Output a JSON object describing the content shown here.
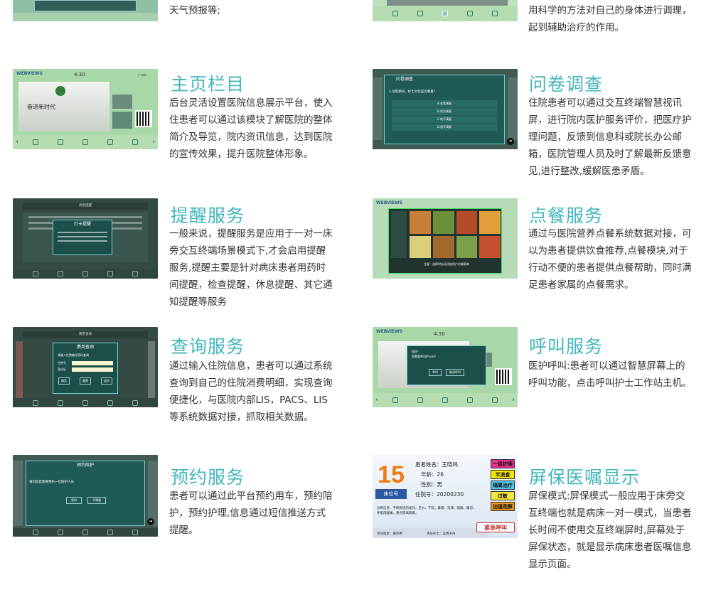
{
  "features": [
    {
      "id": "weather",
      "title": "",
      "desc": "天气预报等;"
    },
    {
      "id": "treatment",
      "title": "",
      "desc": "用科学的方法对自己的身体进行调理，起到辅助治疗的作用。"
    },
    {
      "id": "homepage",
      "title": "主页栏目",
      "desc": "后台灵活设置医院信息展示平台，使入住患者可以通过该模块了解医院的整体简介及导览，院内资讯信息，达到医院的宣传效果，提升医院整体形象。"
    },
    {
      "id": "survey",
      "title": "问卷调查",
      "desc": "住院患者可以通过交互终端智慧视讯屏，进行院内医护服务评价，把医疗护理问题，反馈到信息科或院长办公邮箱，医院管理人员及时了解最新反馈意见,进行整改,缓解医患矛盾。"
    },
    {
      "id": "reminder",
      "title": "提醒服务",
      "desc": "一般来说，提醒服务是应用于一对一床旁交互终端场景模式下,才会启用提醒服务,提醒主要是针对病床患者用药时间提醒，检查提醒，休息提醒、其它通知提醒等服务"
    },
    {
      "id": "ordering",
      "title": "点餐服务",
      "desc": "通过与医院营养点餐系统数据对接，可以为患者提供饮食推荐,点餐模块,对于行动不便的患者提供点餐帮助，同时满足患者家属的点餐需求。"
    },
    {
      "id": "query",
      "title": "查询服务",
      "desc": "通过输入住院信息，患者可以通过系统查询到自己的住院消费明细，实现查询便捷化，与医院内部LIS，PACS、LIS等系统数据对接，抓取相关数据。"
    },
    {
      "id": "call",
      "title": "呼叫服务",
      "desc": "医护呼叫:患者可以通过智慧屏幕上的呼叫功能，点击呼叫护士工作站主机。"
    },
    {
      "id": "booking",
      "title": "预约服务",
      "desc": "患者可以通过此平台预约用车，预约陪护，预约护理,信息通过短信推送方式提醒。"
    },
    {
      "id": "screensaver",
      "title": "屏保医嘱显示",
      "desc": "屏保模式:屏保模式一般应用于床旁交互终端也就是病床一对一模式，当患者长时间不使用交互终端屏时,屏幕处于屏保状态，就是显示病床患者医嘱信息显示页面。"
    }
  ],
  "screens": {
    "homepage": {
      "logo": "WEBVIEWS",
      "time": "4:30",
      "city": "广州市",
      "banner_text": "奋进新时代"
    },
    "survey": {
      "dialog_title": "问卷调查",
      "question": "1.住院期间，护士对您是否尊重？",
      "options": [
        "A.非常满意",
        "B.较为满意",
        "C.较不满意",
        "D.很不满意"
      ]
    },
    "reminder": {
      "header": "消息提醒",
      "dialog_title": "打卡提醒"
    },
    "ordering": {
      "logo": "WEBVIEWS",
      "footer": "注意：选择时自动添加用户点餐菜单"
    },
    "query": {
      "header": "费用查询",
      "dialog_title": "费用查询",
      "prompt": "请输入住院编号密码查询",
      "field1": "住院号",
      "field2": "身份证",
      "btn1": "确定",
      "btn2": "重置",
      "btn3": "返回"
    },
    "call": {
      "logo": "WEBVIEWS",
      "time": "4:30",
      "dialog_text1": "您好！",
      "dialog_text2": "您需要呼叫护士吗？",
      "btn1": "呼叫",
      "btn2": "取消呼叫"
    },
    "booking": {
      "dialog_title": "预约陪护",
      "prompt": "请问您是需要预约一位陪护人员",
      "btn1": "是的",
      "btn2": "不需要"
    },
    "screensaver": {
      "bed_number": "15",
      "bed_label": "床位号",
      "patient_name": "患者姓名：王晓鸣",
      "age": "年龄：26",
      "gender": "性别：男",
      "admission_no": "住院号：20200230",
      "diagnosis": "诊断信息：不明原因的发热、乏力、干咳，鼻塞、流涕、咽痛、腹泻、伴肌肉酸痛，重点隔离观察。",
      "doctor": "责任医生：黄杰秀",
      "nurse": "责任护士：吴晓方丹",
      "tags": [
        {
          "label": "一级护理",
          "color": "#e8318e"
        },
        {
          "label": "半流食",
          "color": "#f7e500"
        },
        {
          "label": "隔离治疗",
          "color": "#4fc8f0"
        },
        {
          "label": "过敏",
          "color": "#f4e63a"
        },
        {
          "label": "加强观察",
          "color": "#f09a1b"
        }
      ],
      "call_button": "紧急呼叫"
    }
  }
}
